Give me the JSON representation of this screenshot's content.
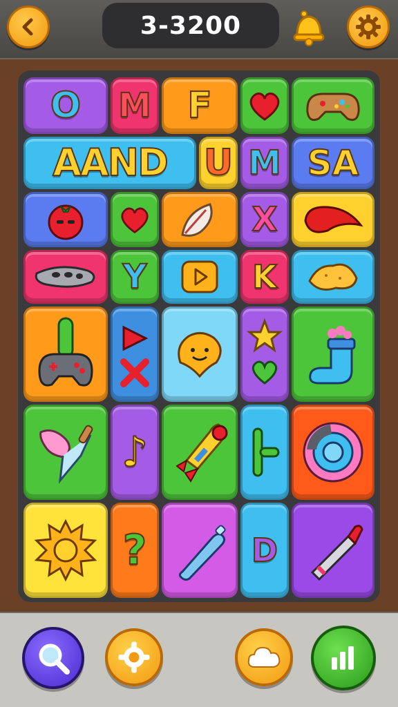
{
  "header": {
    "level_label": "3-3200",
    "icons": [
      "back-arrow-icon",
      "bell-icon",
      "settings-gear-icon"
    ]
  },
  "colors": {
    "purple": "#a45be6",
    "pink": "#f0346e",
    "orange": "#ff9a1a",
    "green": "#4cc53a",
    "sky": "#3fbff0",
    "yellow": "#ffd12e",
    "blue": "#5b7cf0"
  },
  "tiles": [
    {
      "id": "t1",
      "label": "O",
      "icon": "letter-icon",
      "color": "purple"
    },
    {
      "id": "t2",
      "label": "M",
      "icon": "letter-icon",
      "color": "pink"
    },
    {
      "id": "t3",
      "label": "F",
      "icon": "letter-icon",
      "color": "orange"
    },
    {
      "id": "t4",
      "label": "",
      "icon": "heart-icon",
      "color": "green"
    },
    {
      "id": "t5",
      "label": "",
      "icon": "cookie-controller-icon",
      "color": "green"
    },
    {
      "id": "t6",
      "label": "AAND",
      "icon": "word-icon",
      "color": "sky"
    },
    {
      "id": "t7",
      "label": "U",
      "icon": "letter-icon",
      "color": "yellow"
    },
    {
      "id": "t8",
      "label": "M",
      "icon": "letter-icon",
      "color": "purple"
    },
    {
      "id": "t9",
      "label": "SA",
      "icon": "word-icon",
      "color": "blue"
    },
    {
      "id": "t10",
      "label": "",
      "icon": "tomato-icon",
      "color": "blue"
    },
    {
      "id": "t11",
      "label": "",
      "icon": "heart-icon",
      "color": "green"
    },
    {
      "id": "t12",
      "label": "",
      "icon": "leaf-icon",
      "color": "orange"
    },
    {
      "id": "t13",
      "label": "X",
      "icon": "letter-icon",
      "color": "purple"
    },
    {
      "id": "t14",
      "label": "",
      "icon": "chili-pepper-icon",
      "color": "yellow"
    },
    {
      "id": "t15",
      "label": "",
      "icon": "ocarina-icon",
      "color": "pink"
    },
    {
      "id": "t16",
      "label": "Y",
      "icon": "letter-icon",
      "color": "green"
    },
    {
      "id": "t17",
      "label": "",
      "icon": "play-icon",
      "color": "sky"
    },
    {
      "id": "t18",
      "label": "K",
      "icon": "letter-icon",
      "color": "pink"
    },
    {
      "id": "t19",
      "label": "",
      "icon": "chips-icon",
      "color": "sky"
    },
    {
      "id": "t20",
      "label": "",
      "icon": "gamepad-icon",
      "color": "orange"
    },
    {
      "id": "t21",
      "label": "",
      "icon": "shapes-icon",
      "color": "blue"
    },
    {
      "id": "t22",
      "label": "",
      "icon": "smiley-blob-icon",
      "color": "sky"
    },
    {
      "id": "t23",
      "label": "",
      "icon": "star-heart-icon",
      "color": "purple"
    },
    {
      "id": "t24",
      "label": "",
      "icon": "sock-icon",
      "color": "green"
    },
    {
      "id": "t25",
      "label": "",
      "icon": "plunger-icon",
      "color": "green"
    },
    {
      "id": "t26",
      "label": "♪",
      "icon": "music-note-icon",
      "color": "purple"
    },
    {
      "id": "t27",
      "label": "",
      "icon": "rocket-icon",
      "color": "green"
    },
    {
      "id": "t28",
      "label": "",
      "icon": "pipe-icon",
      "color": "sky"
    },
    {
      "id": "t29",
      "label": "",
      "icon": "donut-gear-icon",
      "color": "pink"
    },
    {
      "id": "t30",
      "label": "",
      "icon": "sun-icon",
      "color": "yellow"
    },
    {
      "id": "t31",
      "label": "?",
      "icon": "question-icon",
      "color": "orange"
    },
    {
      "id": "t32",
      "label": "",
      "icon": "bottle-icon",
      "color": "purple"
    },
    {
      "id": "t33",
      "label": "D",
      "icon": "letter-icon",
      "color": "sky"
    },
    {
      "id": "t34",
      "label": "",
      "icon": "lipstick-icon",
      "color": "purple"
    }
  ],
  "footer": {
    "buttons": [
      "search-icon",
      "settings-gear-icon",
      "cloud-icon",
      "stats-icon"
    ]
  }
}
